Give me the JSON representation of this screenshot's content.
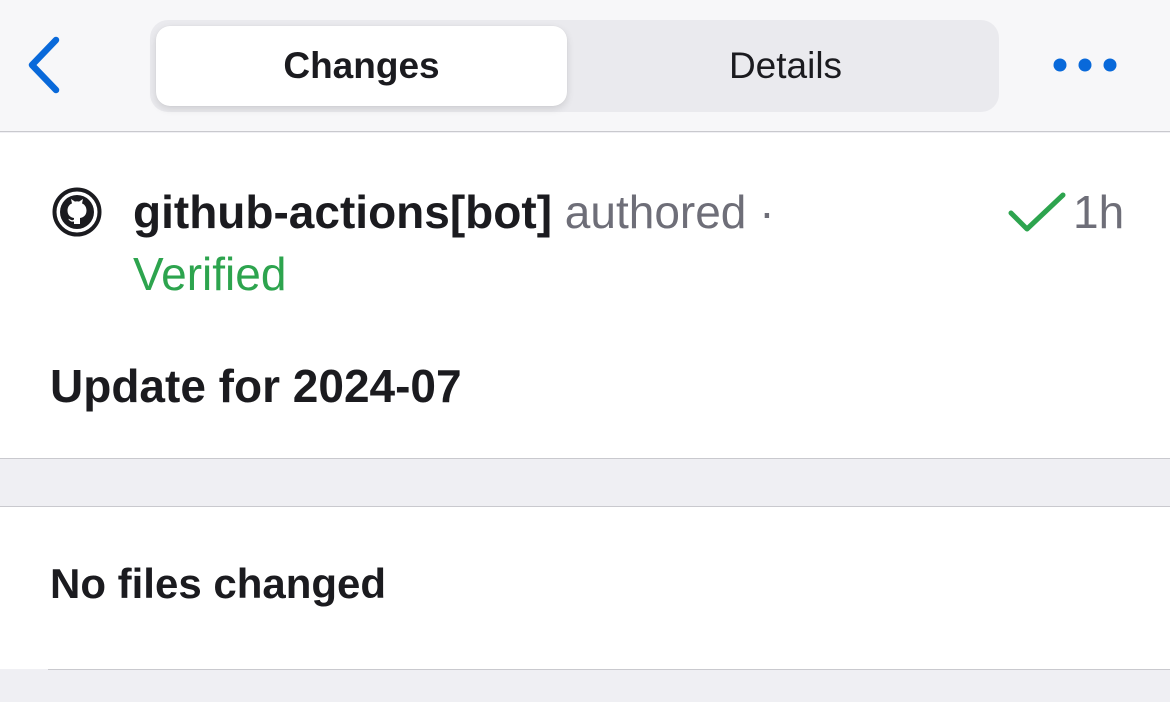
{
  "nav": {
    "back_icon": "chevron-left-icon",
    "tabs": [
      {
        "label": "Changes",
        "active": true
      },
      {
        "label": "Details",
        "active": false
      }
    ],
    "more_icon": "ellipsis-icon",
    "accent_color": "#0969da"
  },
  "commit": {
    "avatar_icon": "github-octocat-icon",
    "author": "github-actions[bot]",
    "action_text": "authored",
    "separator": "·",
    "verified_label": "Verified",
    "status_icon": "checkmark-icon",
    "status_color": "#2da44e",
    "time_ago": "1h",
    "title": "Update for 2024-07"
  },
  "files": {
    "empty_message": "No files changed"
  }
}
